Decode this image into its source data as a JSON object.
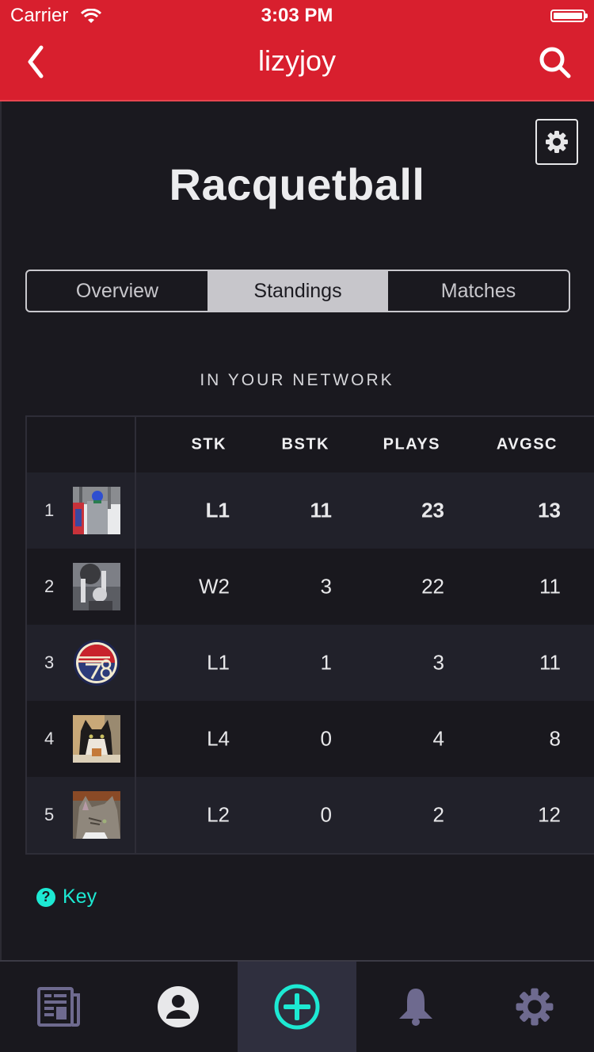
{
  "status_bar": {
    "carrier": "Carrier",
    "time": "3:03 PM"
  },
  "nav": {
    "title": "lizyjoy",
    "back_icon": "chevron-left-icon",
    "search_icon": "search-icon"
  },
  "page": {
    "title": "Racquetball",
    "settings_icon": "gear-icon"
  },
  "segments": [
    {
      "label": "Overview",
      "active": false
    },
    {
      "label": "Standings",
      "active": true
    },
    {
      "label": "Matches",
      "active": false
    }
  ],
  "standings": {
    "section_label": "IN YOUR NETWORK",
    "columns": [
      "STK",
      "BSTK",
      "PLAYS",
      "AVGSC"
    ],
    "rows": [
      {
        "rank": "1",
        "avatar": "snowboarder-photo",
        "stk": "L1",
        "bstk": "11",
        "plays": "23",
        "avgsc": "13",
        "highlight": true
      },
      {
        "rank": "2",
        "avatar": "basketball-photo",
        "stk": "W2",
        "bstk": "3",
        "plays": "22",
        "avgsc": "11"
      },
      {
        "rank": "3",
        "avatar": "78-logo",
        "stk": "L1",
        "bstk": "1",
        "plays": "3",
        "avgsc": "11"
      },
      {
        "rank": "4",
        "avatar": "calico-cat-photo",
        "stk": "L4",
        "bstk": "0",
        "plays": "4",
        "avgsc": "8"
      },
      {
        "rank": "5",
        "avatar": "tabby-cat-photo",
        "stk": "L2",
        "bstk": "0",
        "plays": "2",
        "avgsc": "12"
      }
    ]
  },
  "key": {
    "label": "Key",
    "icon": "?"
  },
  "tabbar": {
    "items": [
      {
        "name": "news",
        "icon": "newspaper-icon",
        "active": false
      },
      {
        "name": "profile",
        "icon": "user-icon",
        "active": false
      },
      {
        "name": "add",
        "icon": "plus-circle-icon",
        "active": true
      },
      {
        "name": "notifications",
        "icon": "bell-icon",
        "active": false
      },
      {
        "name": "settings",
        "icon": "gear-icon",
        "active": false
      }
    ]
  },
  "colors": {
    "brand_red": "#d81f2e",
    "accent_teal": "#1de9d3",
    "background": "#1a191f",
    "inactive_icon": "#6e6a8f"
  }
}
